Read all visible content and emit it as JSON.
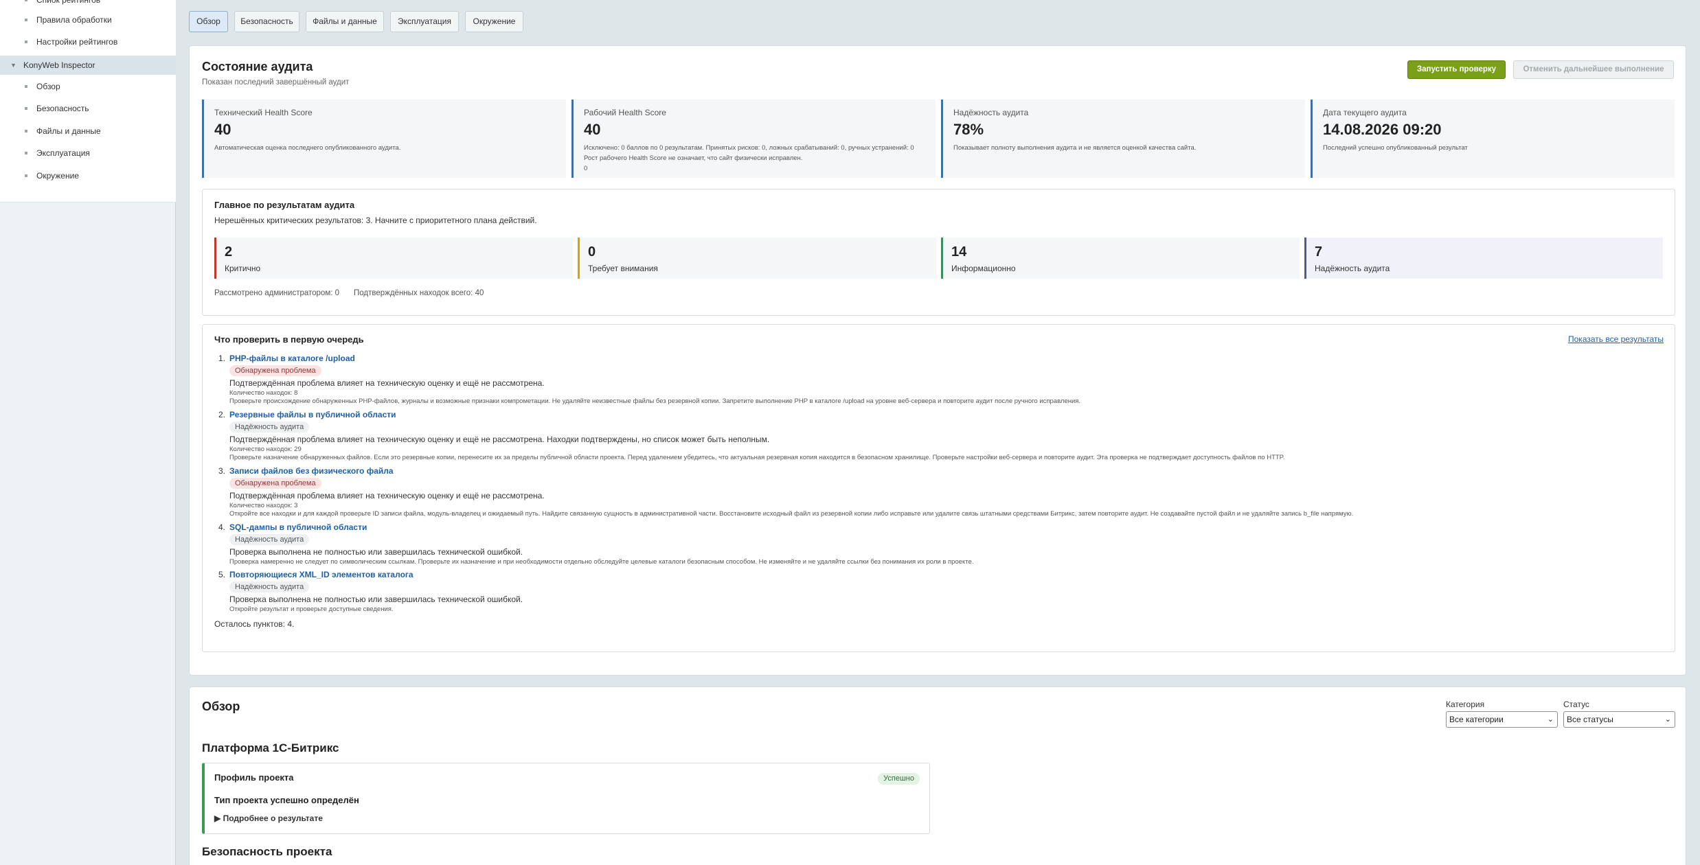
{
  "sidebar": {
    "items": [
      {
        "label": "Спиок рейтингов",
        "level": 1
      },
      {
        "label": "Правила обработки",
        "level": 1
      },
      {
        "label": "Настройки рейтингов",
        "level": 1
      },
      {
        "label": "KonyWeb Inspector",
        "level": 0
      },
      {
        "label": "Обзор",
        "level": 1
      },
      {
        "label": "Безопасность",
        "level": 1
      },
      {
        "label": "Файлы и данные",
        "level": 1
      },
      {
        "label": "Эксплуатация",
        "level": 1
      },
      {
        "label": "Окружение",
        "level": 1
      }
    ]
  },
  "tabs": [
    {
      "label": "Обзор",
      "active": true
    },
    {
      "label": "Безопасность",
      "active": false
    },
    {
      "label": "Файлы и данные",
      "active": false
    },
    {
      "label": "Эксплуатация",
      "active": false
    },
    {
      "label": "Окружение",
      "active": false
    }
  ],
  "audit": {
    "title": "Состояние аудита",
    "subtitle": "Показан последний завершённый аудит",
    "run_button": "Запустить проверку",
    "cancel_button": "Отменить дальнейшее выполнение",
    "scores": [
      {
        "label": "Технический Health Score",
        "value": "40",
        "desc": "Автоматическая оценка последнего опубликованного аудита."
      },
      {
        "label": "Рабочий Health Score",
        "value": "40",
        "desc": "Исключено: 0 баллов по 0 результатам. Принятых рисков: 0, ложных срабатываний: 0, ручных устранений: 0",
        "desc2": "Рост рабочего Health Score не означает, что сайт физически исправлен.",
        "desc3": "0"
      },
      {
        "label": "Надёжность аудита",
        "value": "78%",
        "desc": "Показывает полноту выполнения аудита и не является оценкой качества сайта."
      },
      {
        "label": "Дата текущего аудита",
        "value": "14.08.2026 09:20",
        "desc": "Последний успешно опубликованный результат"
      }
    ]
  },
  "summary": {
    "title": "Главное по результатам аудита",
    "text": "Нерешённых критических результатов: 3. Начните с приоритетного плана действий.",
    "stats": [
      {
        "value": "2",
        "label": "Критично",
        "color": "#c0392b"
      },
      {
        "value": "0",
        "label": "Требует внимания",
        "color": "#e0a100"
      },
      {
        "value": "14",
        "label": "Информационно",
        "color": "#3b8f5a"
      },
      {
        "value": "7",
        "label": "Надёжность аудита",
        "color": "#4b5f8a"
      }
    ],
    "reviewed": "Рассмотрено администратором: 0",
    "confirmed": "Подтверждённых находок всего: 40"
  },
  "priority": {
    "title": "Что проверить в первую очередь",
    "show_all": "Показать все результаты",
    "items": [
      {
        "num": "1.",
        "title": "PHP-файлы в каталоге /upload",
        "badge": "Обнаружена проблема",
        "badge_type": "red",
        "desc": "Подтверждённая проблема влияет на техническую оценку и ещё не рассмотрена.",
        "count": "Количество находок: 8",
        "rec": "Проверьте происхождение обнаруженных PHP-файлов, журналы и возможные признаки компрометации. Не удаляйте неизвестные файлы без резервной копии. Запретите выполнение PHP в каталоге /upload на уровне веб-сервера и повторите аудит после ручного исправления."
      },
      {
        "num": "2.",
        "title": "Резервные файлы в публичной области",
        "badge": "Надёжность аудита",
        "badge_type": "grey",
        "desc": "Подтверждённая проблема влияет на техническую оценку и ещё не рассмотрена. Находки подтверждены, но список может быть неполным.",
        "count": "Количество находок: 29",
        "rec": "Проверьте назначение обнаруженных файлов. Если это резервные копии, перенесите их за пределы публичной области проекта. Перед удалением убедитесь, что актуальная резервная копия находится в безопасном хранилище. Проверьте настройки веб-сервера и повторите аудит. Эта проверка не подтверждает доступность файлов по HTTP."
      },
      {
        "num": "3.",
        "title": "Записи файлов без физического файла",
        "badge": "Обнаружена проблема",
        "badge_type": "red",
        "desc": "Подтверждённая проблема влияет на техническую оценку и ещё не рассмотрена.",
        "count": "Количество находок: 3",
        "rec": "Откройте все находки и для каждой проверьте ID записи файла, модуль-владелец и ожидаемый путь. Найдите связанную сущность в административной части. Восстановите исходный файл из резервной копии либо исправьте или удалите связь штатными средствами Битрикс, затем повторите аудит. Не создавайте пустой файл и не удаляйте запись b_file напрямую."
      },
      {
        "num": "4.",
        "title": "SQL-дампы в публичной области",
        "badge": "Надёжность аудита",
        "badge_type": "grey",
        "desc": "Проверка выполнена не полностью или завершилась технической ошибкой.",
        "count": "",
        "rec": "Проверка намеренно не следует по символическим ссылкам. Проверьте их назначение и при необходимости отдельно обследуйте целевые каталоги безопасным способом. Не изменяйте и не удаляйте ссылки без понимания их роли в проекте."
      },
      {
        "num": "5.",
        "title": "Повторяющиеся XML_ID элементов каталога",
        "badge": "Надёжность аудита",
        "badge_type": "grey",
        "desc": "Проверка выполнена не полностью или завершилась технической ошибкой.",
        "count": "",
        "rec": "Откройте результат и проверьте доступные сведения."
      }
    ],
    "remaining": "Осталось пунктов: 4."
  },
  "overview": {
    "title": "Обзор",
    "category_label": "Категория",
    "category_value": "Все категории",
    "status_label": "Статус",
    "status_value": "Все статусы",
    "section_platform": "Платформа 1С-Битрикс",
    "card": {
      "title": "Профиль проекта",
      "status": "Успешно",
      "result": "Тип проекта успешно определён",
      "details": "▶ Подробнее о результате"
    },
    "section_security": "Безопасность проекта"
  }
}
